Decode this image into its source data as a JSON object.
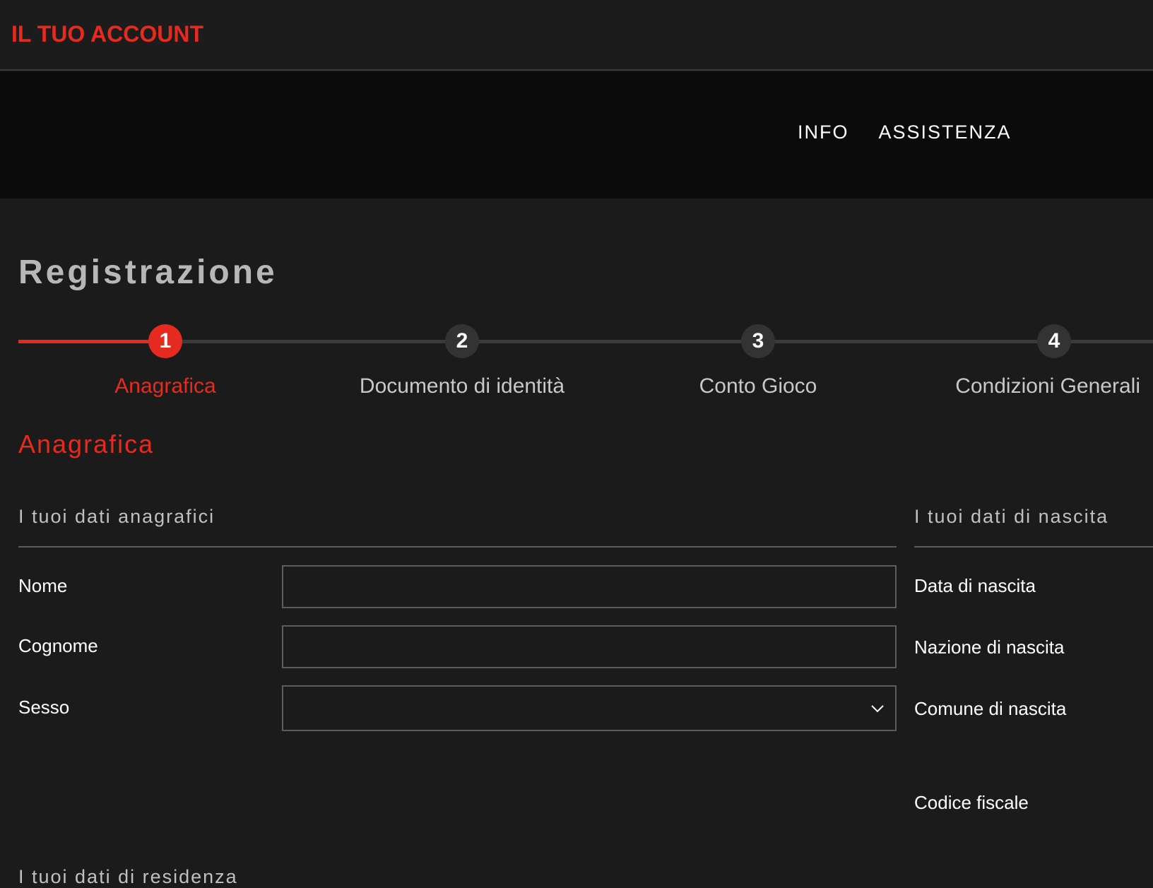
{
  "header": {
    "account_label": "IL TUO ACCOUNT"
  },
  "nav": {
    "items": [
      {
        "label": "INFO"
      },
      {
        "label": "ASSISTENZA"
      }
    ]
  },
  "page": {
    "title": "Registrazione"
  },
  "stepper": {
    "current_step": 1,
    "steps": [
      {
        "number": "1",
        "label": "Anagrafica"
      },
      {
        "number": "2",
        "label": "Documento di identità"
      },
      {
        "number": "3",
        "label": "Conto Gioco"
      },
      {
        "number": "4",
        "label": "Condizioni Generali"
      }
    ]
  },
  "section": {
    "title": "Anagrafica",
    "personal": {
      "heading": "I tuoi dati anagrafici",
      "fields": {
        "nome": {
          "label": "Nome",
          "value": ""
        },
        "cognome": {
          "label": "Cognome",
          "value": ""
        },
        "sesso": {
          "label": "Sesso",
          "value": ""
        }
      }
    },
    "birth": {
      "heading": "I tuoi dati di nascita",
      "fields": {
        "data_nascita": {
          "label": "Data di nascita"
        },
        "nazione_nascita": {
          "label": "Nazione di nascita"
        },
        "comune_nascita": {
          "label": "Comune di nascita"
        },
        "codice_fiscale": {
          "label": "Codice fiscale"
        }
      }
    },
    "residence": {
      "heading": "I tuoi dati di residenza"
    }
  },
  "colors": {
    "accent": "#e52b1f",
    "background": "#1b1b1b",
    "nav_background": "#0b0b0b",
    "step_inactive": "#333333"
  },
  "icons": {
    "select_chevron": "chevron-down-icon"
  }
}
